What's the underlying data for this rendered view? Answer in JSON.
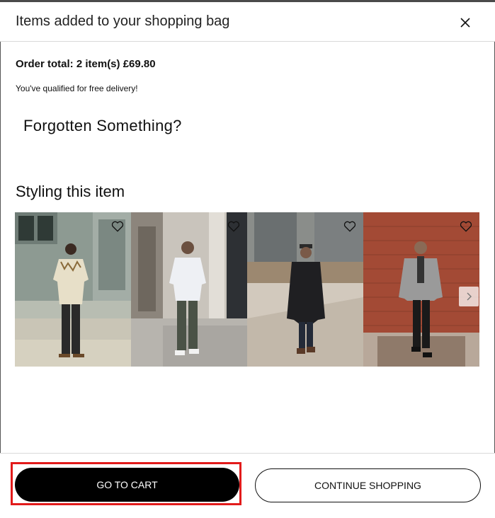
{
  "header": {
    "title": "Items added to your shopping bag",
    "close_icon": "close-icon"
  },
  "order": {
    "total": "Order total: 2 item(s) £69.80",
    "delivery": "You've qualified for free delivery!"
  },
  "sections": {
    "forgotten": "Forgotten Something?",
    "styling": "Styling this item"
  },
  "carousel": {
    "items": [
      {
        "alt": "Man in printed short-sleeve shirt and dark trousers",
        "wishlist_icon": "heart-icon"
      },
      {
        "alt": "Man in white striped shirt and grey chinos",
        "wishlist_icon": "heart-icon"
      },
      {
        "alt": "Man in long black overcoat and flat cap",
        "wishlist_icon": "heart-icon"
      },
      {
        "alt": "Man in grey jacket and scarf",
        "wishlist_icon": "heart-icon"
      }
    ],
    "next_icon": "chevron-right-icon"
  },
  "footer": {
    "go_to_cart": "GO TO CART",
    "continue_shopping": "CONTINUE SHOPPING"
  },
  "colors": {
    "primary_button": "#000000",
    "highlight": "#e21b1b"
  }
}
